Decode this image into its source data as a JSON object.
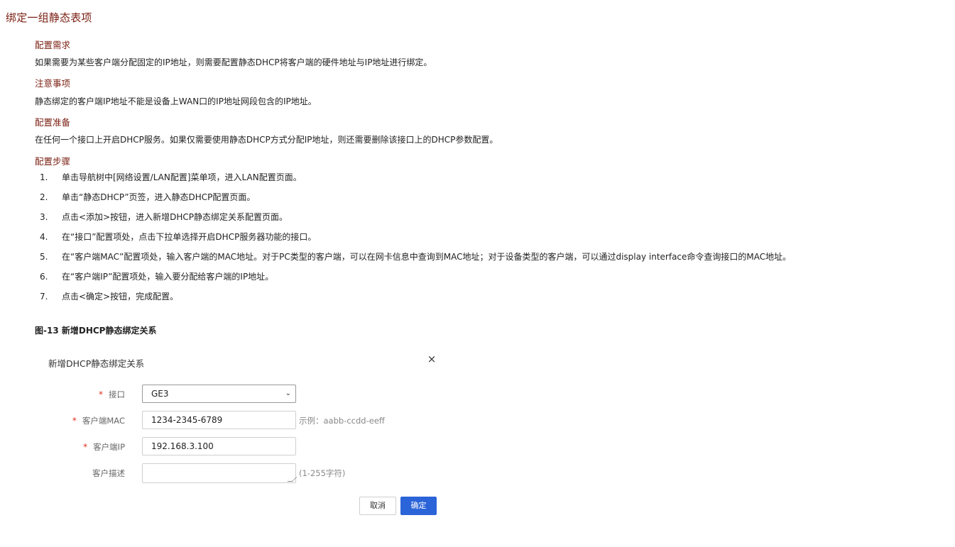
{
  "page": {
    "title": "绑定一组静态表项"
  },
  "sections": {
    "requirement": {
      "heading": "配置需求",
      "text": "如果需要为某些客户端分配固定的IP地址，则需要配置静态DHCP将客户端的硬件地址与IP地址进行绑定。"
    },
    "notice": {
      "heading": "注意事项",
      "text": "静态绑定的客户端IP地址不能是设备上WAN口的IP地址网段包含的IP地址。"
    },
    "preparation": {
      "heading": "配置准备",
      "text": "在任何一个接口上开启DHCP服务。如果仅需要使用静态DHCP方式分配IP地址，则还需要删除该接口上的DHCP参数配置。"
    },
    "steps": {
      "heading": "配置步骤",
      "items": [
        {
          "num": "1.",
          "text": "单击导航树中[网络设置/LAN配置]菜单项，进入LAN配置页面。"
        },
        {
          "num": "2.",
          "text": "单击“静态DHCP”页签，进入静态DHCP配置页面。"
        },
        {
          "num": "3.",
          "text": "点击<添加>按钮，进入新增DHCP静态绑定关系配置页面。"
        },
        {
          "num": "4.",
          "text": "在“接口”配置项处，点击下拉单选择开启DHCP服务器功能的接口。"
        },
        {
          "num": "5.",
          "text": "在“客户端MAC”配置项处，输入客户端的MAC地址。对于PC类型的客户端，可以在网卡信息中查询到MAC地址；对于设备类型的客户端，可以通过display interface命令查询接口的MAC地址。"
        },
        {
          "num": "6.",
          "text": "在“客户端IP”配置项处，输入要分配给客户端的IP地址。"
        },
        {
          "num": "7.",
          "text": "点击<确定>按钮，完成配置。"
        }
      ]
    }
  },
  "figure": {
    "caption": "图-13 新增DHCP静态绑定关系"
  },
  "dialog": {
    "title": "新增DHCP静态绑定关系",
    "close_icon": "×",
    "required_mark": "*",
    "fields": {
      "interface": {
        "label": "接口",
        "value": "GE3",
        "chevron": "⌄"
      },
      "mac": {
        "label": "客户端MAC",
        "value": "1234-2345-6789",
        "hint": "示例：aabb-ccdd-eeff"
      },
      "ip": {
        "label": "客户端IP",
        "value": "192.168.3.100"
      },
      "description": {
        "label": "客户描述",
        "value": "",
        "hint": "(1-255字符)"
      }
    },
    "buttons": {
      "cancel": "取消",
      "ok": "确定"
    },
    "colors": {
      "primary": "#2b63d8",
      "required": "#e0301e",
      "heading": "#7a1f12"
    }
  }
}
